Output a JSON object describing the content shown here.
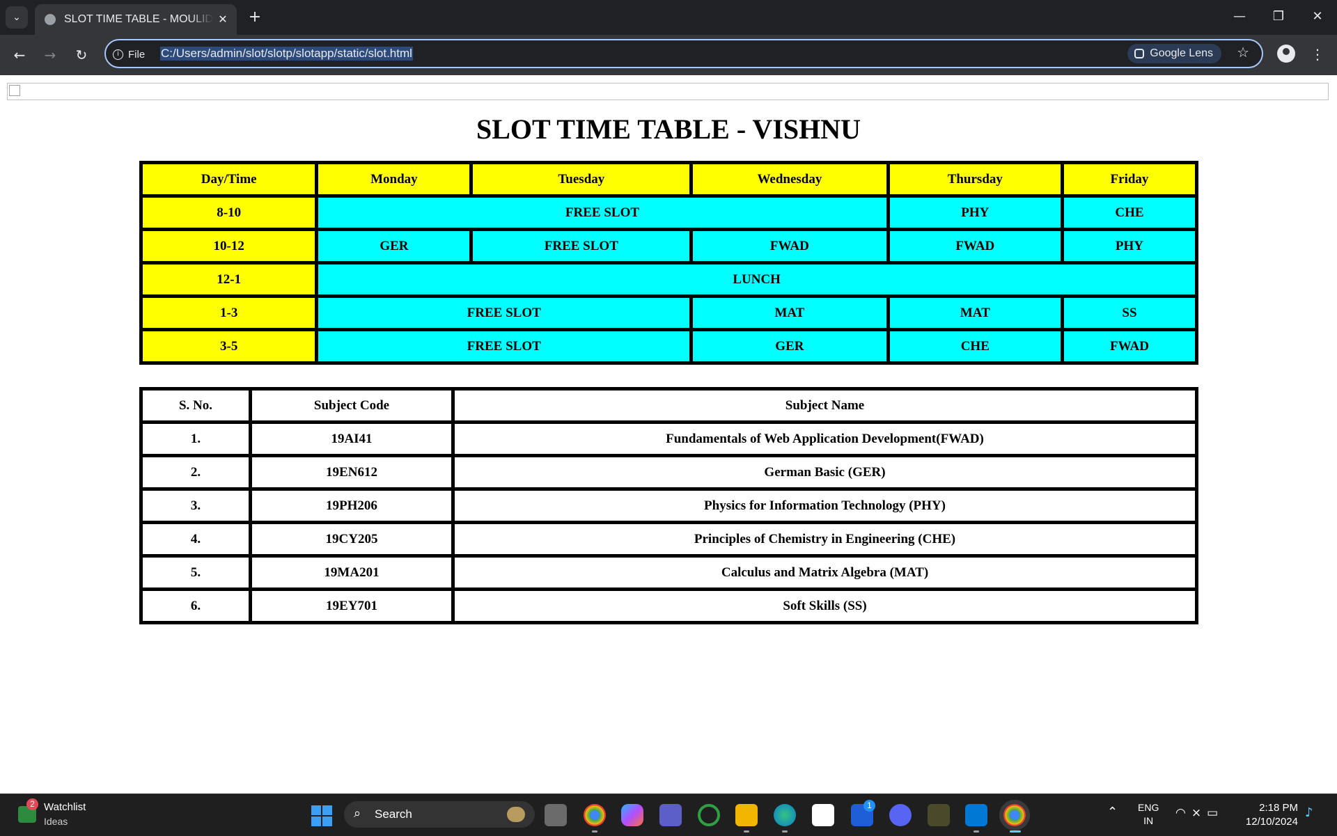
{
  "browser": {
    "tab_title": "SLOT TIME TABLE - MOULIDHARAN",
    "tab_close": "✕",
    "new_tab": "+",
    "site_info_label": "File",
    "url": "C:/Users/admin/slot/slotp/slotapp/static/slot.html",
    "lens_label": "Google Lens"
  },
  "page": {
    "title": "SLOT TIME TABLE - VISHNU"
  },
  "timetable": {
    "headers": [
      "Day/Time",
      "Monday",
      "Tuesday",
      "Wednesday",
      "Thursday",
      "Friday"
    ],
    "rows": [
      {
        "time": "8-10",
        "cells": [
          "FREE SLOT",
          "PHY",
          "CHE"
        ]
      },
      {
        "time": "10-12",
        "cells": [
          "GER",
          "FREE SLOT",
          "FWAD",
          "FWAD",
          "PHY"
        ]
      },
      {
        "time": "12-1",
        "cells": [
          "LUNCH"
        ]
      },
      {
        "time": "1-3",
        "cells": [
          "FREE SLOT",
          "MAT",
          "MAT",
          "SS"
        ]
      },
      {
        "time": "3-5",
        "cells": [
          "FREE SLOT",
          "GER",
          "CHE",
          "FWAD"
        ]
      }
    ],
    "colors": {
      "day_cell": "#ffff00",
      "slot_cell": "#00ffff"
    }
  },
  "subjects": {
    "headers": [
      "S. No.",
      "Subject Code",
      "Subject Name"
    ],
    "rows": [
      [
        "1.",
        "19AI41",
        "Fundamentals of Web Application Development(FWAD)"
      ],
      [
        "2.",
        "19EN612",
        "German Basic (GER)"
      ],
      [
        "3.",
        "19PH206",
        "Physics for Information Technology (PHY)"
      ],
      [
        "4.",
        "19CY205",
        "Principles of Chemistry in Engineering (CHE)"
      ],
      [
        "5.",
        "19MA201",
        "Calculus and Matrix Algebra (MAT)"
      ],
      [
        "6.",
        "19EY701",
        "Soft Skills (SS)"
      ]
    ]
  },
  "taskbar": {
    "widget_title": "Watchlist",
    "widget_subtitle": "Ideas",
    "widget_badge": "2",
    "search_label": "Search",
    "outlook_badge": "1",
    "lang_line1": "ENG",
    "lang_line2": "IN",
    "time": "2:18 PM",
    "date": "12/10/2024"
  }
}
